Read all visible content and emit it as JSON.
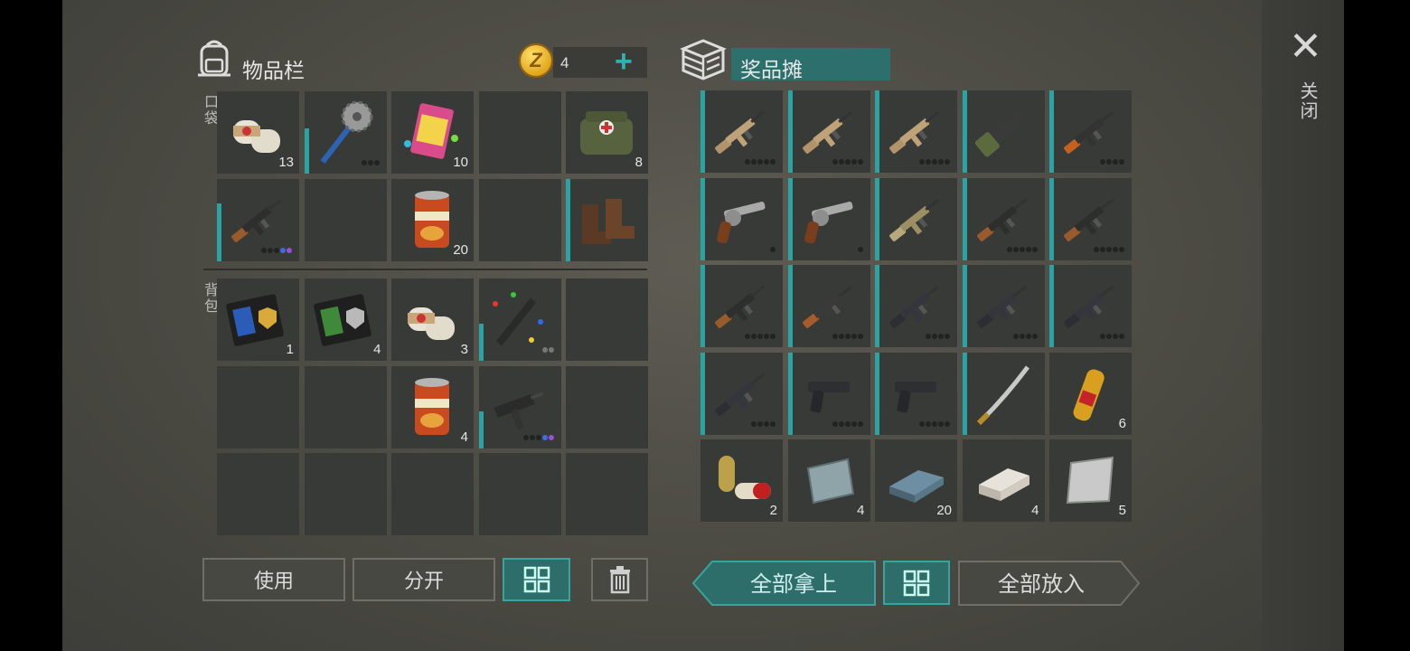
{
  "inventory": {
    "title": "物品栏",
    "pocket_label": "口袋",
    "backpack_label": "背包"
  },
  "currency": {
    "amount": "4",
    "coin_symbol": "Z",
    "add_symbol": "+"
  },
  "loot": {
    "title": "奖品摊"
  },
  "close": {
    "symbol": "✕",
    "label": "关闭"
  },
  "buttons": {
    "use": "使用",
    "split": "分开",
    "take_all": "全部拿上",
    "put_all": "全部放入"
  },
  "colors": {
    "accent": "#2aa4a3",
    "panel": "#383a37",
    "background": "#4b4a43"
  },
  "pocket_slots": [
    {
      "icon": "bandage-icon",
      "qty": "13",
      "condition": 0
    },
    {
      "icon": "saw-blade-mace-icon",
      "qty": "",
      "condition": 0.55,
      "dots": [
        "d",
        "d",
        "d"
      ]
    },
    {
      "icon": "confetti-pack-icon",
      "qty": "10",
      "condition": 0
    },
    {
      "icon": "",
      "qty": "",
      "condition": 0
    },
    {
      "icon": "medkit-bag-icon",
      "qty": "8",
      "condition": 0
    },
    {
      "icon": "shotgun-icon",
      "qty": "",
      "condition": 0.7,
      "dots": [
        "d",
        "d",
        "d",
        "blue",
        "purple"
      ]
    },
    {
      "icon": "",
      "qty": "",
      "condition": 0
    },
    {
      "icon": "canned-food-icon",
      "qty": "20",
      "condition": 0
    },
    {
      "icon": "",
      "qty": "",
      "condition": 0
    },
    {
      "icon": "boots-icon",
      "qty": "",
      "condition": 1
    }
  ],
  "backpack_slots": [
    {
      "icon": "police-badge-blue-icon",
      "qty": "1",
      "condition": 0
    },
    {
      "icon": "police-badge-green-icon",
      "qty": "4",
      "condition": 0
    },
    {
      "icon": "bandage-icon",
      "qty": "3",
      "condition": 0
    },
    {
      "icon": "confetti-launcher-icon",
      "qty": "",
      "condition": 0.45,
      "dots": [
        "grey",
        "grey"
      ]
    },
    {
      "icon": "",
      "qty": "",
      "condition": 0
    },
    {
      "icon": "",
      "qty": "",
      "condition": 0
    },
    {
      "icon": "",
      "qty": "",
      "condition": 0
    },
    {
      "icon": "canned-food-icon",
      "qty": "4",
      "condition": 0
    },
    {
      "icon": "uzi-icon",
      "qty": "",
      "condition": 0.45,
      "dots": [
        "d",
        "d",
        "d",
        "blue",
        "purple"
      ]
    },
    {
      "icon": "",
      "qty": "",
      "condition": 0
    },
    {
      "icon": "",
      "qty": "",
      "condition": 0
    },
    {
      "icon": "",
      "qty": "",
      "condition": 0
    },
    {
      "icon": "",
      "qty": "",
      "condition": 0
    },
    {
      "icon": "",
      "qty": "",
      "condition": 0
    },
    {
      "icon": "",
      "qty": "",
      "condition": 0
    }
  ],
  "loot_slots": [
    {
      "icon": "scar-rifle-icon",
      "qty": "",
      "condition": 1,
      "dots": [
        "d",
        "d",
        "d",
        "d",
        "d"
      ]
    },
    {
      "icon": "scar-rifle-icon",
      "qty": "",
      "condition": 1,
      "dots": [
        "d",
        "d",
        "d",
        "d",
        "d"
      ]
    },
    {
      "icon": "scar-rifle-icon",
      "qty": "",
      "condition": 1,
      "dots": [
        "d",
        "d",
        "d",
        "d",
        "d"
      ]
    },
    {
      "icon": "minigun-icon",
      "qty": "",
      "condition": 1,
      "dots": []
    },
    {
      "icon": "svd-rifle-icon",
      "qty": "",
      "condition": 1,
      "dots": [
        "d",
        "d",
        "d",
        "d"
      ]
    },
    {
      "icon": "revolver-icon",
      "qty": "",
      "condition": 1,
      "dots": [
        "d"
      ]
    },
    {
      "icon": "revolver-icon",
      "qty": "",
      "condition": 1,
      "dots": [
        "d"
      ]
    },
    {
      "icon": "rocket-launcher-icon",
      "qty": "",
      "condition": 1,
      "dots": []
    },
    {
      "icon": "shotgun-icon",
      "qty": "",
      "condition": 1,
      "dots": [
        "d",
        "d",
        "d",
        "d",
        "d"
      ]
    },
    {
      "icon": "shotgun-icon",
      "qty": "",
      "condition": 1,
      "dots": [
        "d",
        "d",
        "d",
        "d",
        "d"
      ]
    },
    {
      "icon": "shotgun-icon",
      "qty": "",
      "condition": 1,
      "dots": [
        "d",
        "d",
        "d",
        "d",
        "d"
      ]
    },
    {
      "icon": "ak-rifle-icon",
      "qty": "",
      "condition": 1,
      "dots": [
        "d",
        "d",
        "d",
        "d",
        "d"
      ]
    },
    {
      "icon": "m16-rifle-icon",
      "qty": "",
      "condition": 1,
      "dots": [
        "d",
        "d",
        "d",
        "d"
      ]
    },
    {
      "icon": "m16-rifle-icon",
      "qty": "",
      "condition": 1,
      "dots": [
        "d",
        "d",
        "d",
        "d"
      ]
    },
    {
      "icon": "m16-rifle-icon",
      "qty": "",
      "condition": 1,
      "dots": [
        "d",
        "d",
        "d",
        "d"
      ]
    },
    {
      "icon": "m16-rifle-icon",
      "qty": "",
      "condition": 1,
      "dots": [
        "d",
        "d",
        "d",
        "d"
      ]
    },
    {
      "icon": "pistol-icon",
      "qty": "",
      "condition": 1,
      "dots": [
        "d",
        "d",
        "d",
        "d",
        "d"
      ]
    },
    {
      "icon": "pistol-icon",
      "qty": "",
      "condition": 1,
      "dots": [
        "d",
        "d",
        "d",
        "d",
        "d"
      ]
    },
    {
      "icon": "katana-icon",
      "qty": "",
      "condition": 1,
      "dots": []
    },
    {
      "icon": "ampoule-icon",
      "qty": "6",
      "condition": 0
    },
    {
      "icon": "pills-icon",
      "qty": "2",
      "condition": 0
    },
    {
      "icon": "metal-plate-icon",
      "qty": "4",
      "condition": 0
    },
    {
      "icon": "steel-ingot-icon",
      "qty": "20",
      "condition": 0
    },
    {
      "icon": "silver-ingot-icon",
      "qty": "4",
      "condition": 0
    },
    {
      "icon": "aluminum-sheet-icon",
      "qty": "5",
      "condition": 0
    }
  ]
}
